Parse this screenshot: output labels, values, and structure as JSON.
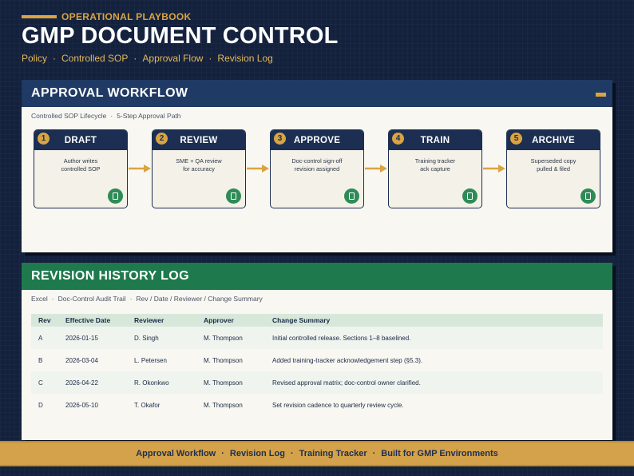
{
  "header": {
    "eyebrow": "OPERATIONAL PLAYBOOK",
    "title": "GMP DOCUMENT CONTROL",
    "nav": [
      "Policy",
      "Controlled SOP",
      "Approval Flow",
      "Revision Log"
    ],
    "separator": "·"
  },
  "workflow": {
    "title": "APPROVAL WORKFLOW",
    "subtitle_parts": [
      "Controlled SOP Lifecycle",
      "5-Step Approval Path"
    ],
    "steps": [
      {
        "num": "1",
        "name": "DRAFT",
        "desc1": "Author writes",
        "desc2": "controlled SOP",
        "icon": "document-icon"
      },
      {
        "num": "2",
        "name": "REVIEW",
        "desc1": "SME + QA review",
        "desc2": "for accuracy",
        "icon": "document-icon"
      },
      {
        "num": "3",
        "name": "APPROVE",
        "desc1": "Doc-control sign-off",
        "desc2": "revision assigned",
        "icon": "document-icon"
      },
      {
        "num": "4",
        "name": "TRAIN",
        "desc1": "Training tracker",
        "desc2": "ack capture",
        "icon": "document-icon"
      },
      {
        "num": "5",
        "name": "ARCHIVE",
        "desc1": "Superseded copy",
        "desc2": "pulled & filed",
        "icon": "document-icon"
      }
    ]
  },
  "revisions": {
    "title": "REVISION HISTORY LOG",
    "subtitle_parts": [
      "Excel",
      "Doc-Control Audit Trail",
      "Rev / Date / Reviewer / Change Summary"
    ],
    "columns": [
      "Rev",
      "Effective Date",
      "Reviewer",
      "Approver",
      "Change Summary"
    ],
    "rows": [
      [
        "A",
        "2026-01-15",
        "D. Singh",
        "M. Thompson",
        "Initial controlled release. Sections 1–8 baselined."
      ],
      [
        "B",
        "2026-03-04",
        "L. Petersen",
        "M. Thompson",
        "Added training-tracker acknowledgement step (§5.3)."
      ],
      [
        "C",
        "2026-04-22",
        "R. Okonkwo",
        "M. Thompson",
        "Revised approval matrix; doc-control owner clarified."
      ],
      [
        "D",
        "2026-05-10",
        "T. Okafor",
        "M. Thompson",
        "Set revision cadence to quarterly review cycle."
      ]
    ]
  },
  "footer": {
    "items": [
      "Approval Workflow",
      "Revision Log",
      "Training Tracker",
      "Built for GMP Environments"
    ]
  },
  "colors": {
    "background": "#13213d",
    "accent_gold": "#d9a441",
    "workflow_header": "#1f3a64",
    "revision_header": "#1e7a4c",
    "step_icon": "#2e8b57"
  }
}
